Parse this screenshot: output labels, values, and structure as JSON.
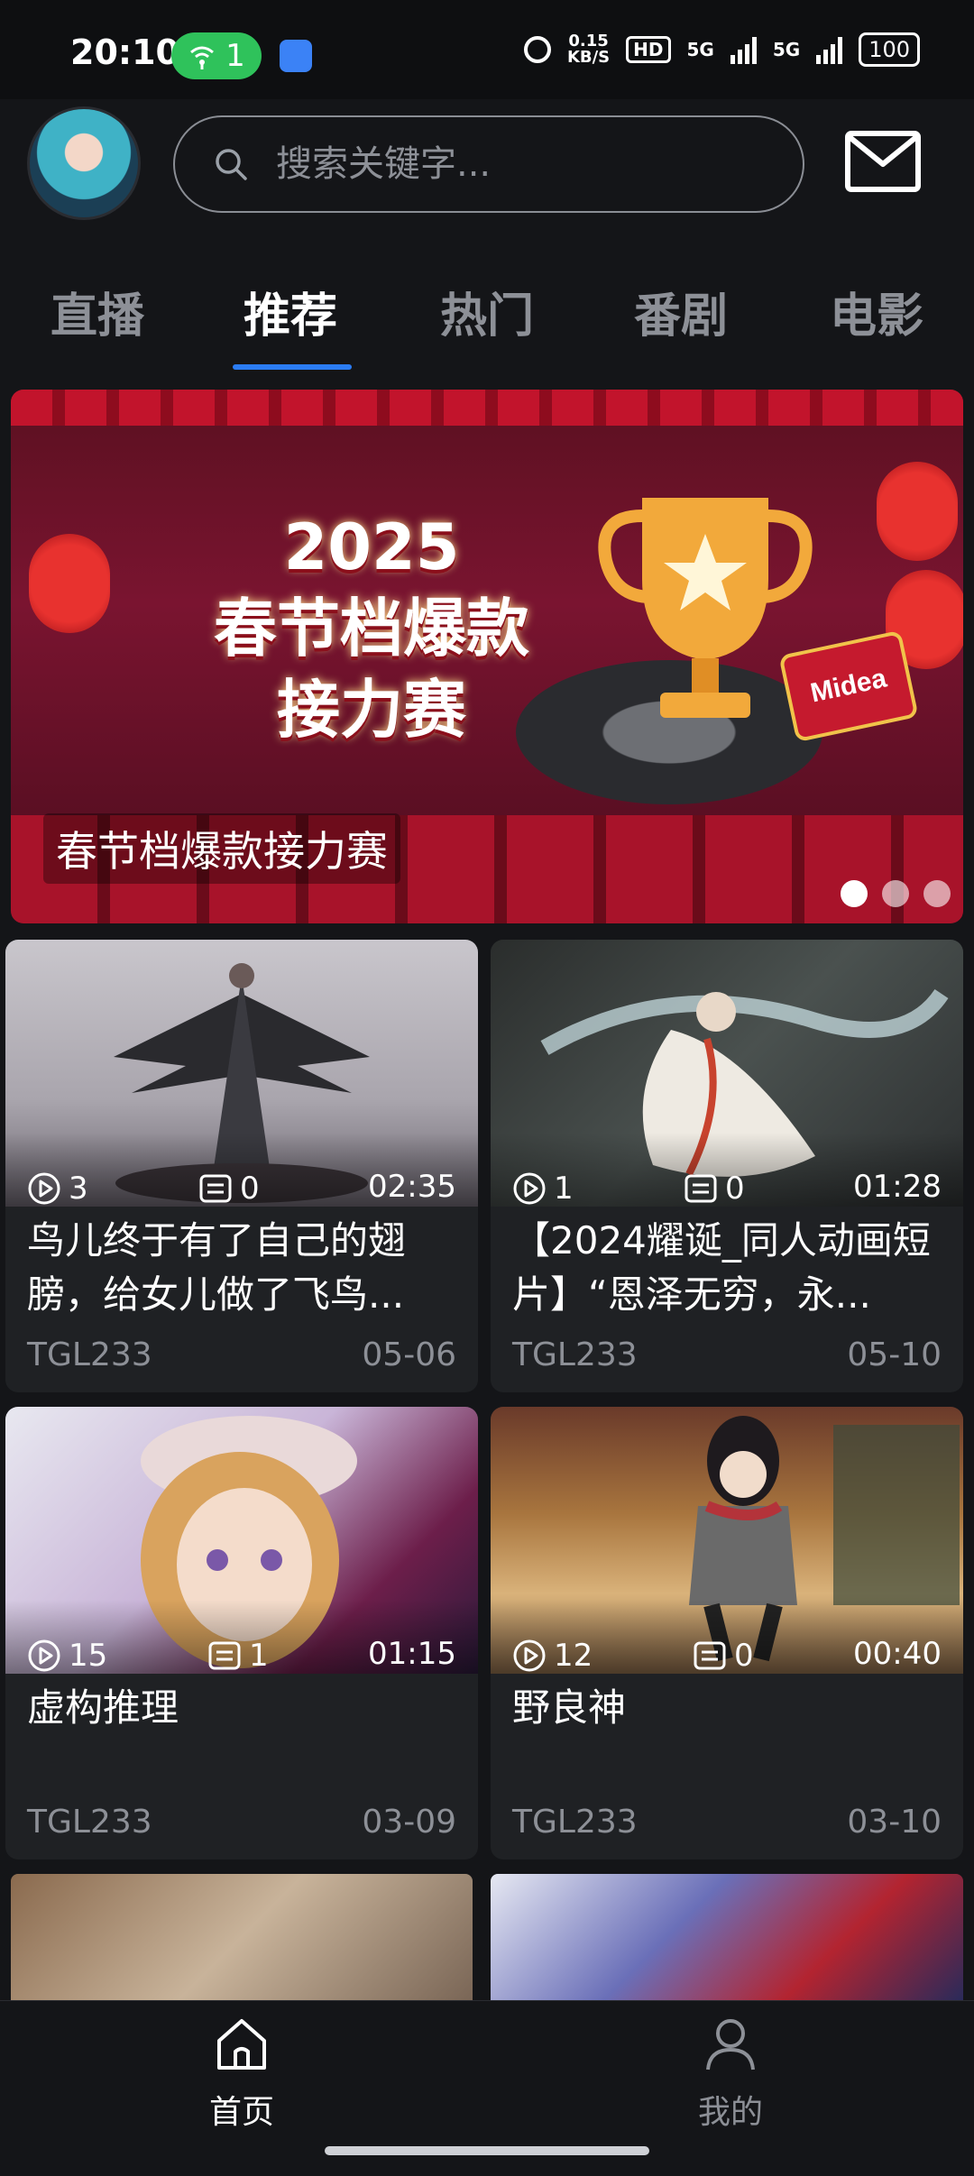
{
  "status_bar": {
    "time": "20:10",
    "hotspot_count": "1",
    "net_speed_value": "0.15",
    "net_speed_unit": "KB/S",
    "hd_label": "HD",
    "network_1": "5G",
    "network_2": "5G",
    "battery": "100"
  },
  "header": {
    "search_placeholder": "搜索关键字..."
  },
  "tabs": [
    "直播",
    "推荐",
    "热门",
    "番剧",
    "电影"
  ],
  "active_tab": "推荐",
  "banner": {
    "art_line1": "2025",
    "art_line2": "春节档爆款",
    "art_line3": "接力赛",
    "brand": "Midea",
    "caption": "春节档爆款接力赛",
    "page_count": 3,
    "active_page": 1
  },
  "videos": [
    {
      "plays": "3",
      "comments": "0",
      "duration": "02:35",
      "title": "鸟儿终于有了自己的翅膀，给女儿做了飞鸟...",
      "author": "TGL233",
      "date": "05-06"
    },
    {
      "plays": "1",
      "comments": "0",
      "duration": "01:28",
      "title": "【2024耀诞_同人动画短片】“恩泽无穷，永...",
      "author": "TGL233",
      "date": "05-10"
    },
    {
      "plays": "15",
      "comments": "1",
      "duration": "01:15",
      "title": "虚构推理",
      "author": "TGL233",
      "date": "03-09"
    },
    {
      "plays": "12",
      "comments": "0",
      "duration": "00:40",
      "title": "野良神",
      "author": "TGL233",
      "date": "03-10"
    }
  ],
  "bottom_nav": {
    "home": "首页",
    "me": "我的"
  },
  "colors": {
    "background": "#141518",
    "card": "#1f2124",
    "accent": "#2b7cf4",
    "muted_text": "#8d9097"
  }
}
